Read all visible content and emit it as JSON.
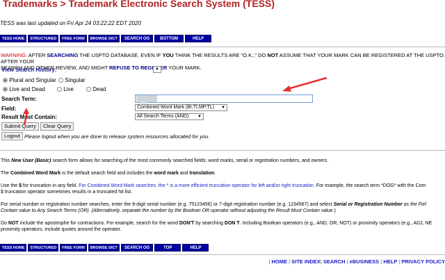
{
  "header": {
    "title_prefix": "Trademarks",
    "title_sep": " > ",
    "title_main": "Trademark Electronic Search System (TESS)",
    "last_updated": "TESS was last updated on Fri Apr 24 03:22:22 EDT 2020"
  },
  "top_nav": [
    "TESS HOME",
    "STRUCTURED",
    "FREE FORM",
    "BROWSE DICT",
    "SEARCH OG",
    "BOTTOM",
    "HELP"
  ],
  "bottom_nav": [
    "TESS HOME",
    "STRUCTURED",
    "FREE FORM",
    "BROWSE DICT",
    "SEARCH OG",
    "TOP",
    "HELP"
  ],
  "warning": {
    "label": "WARNING:",
    "t1": " AFTER ",
    "searching": "SEARCHING",
    "t2": " THE USPTO DATABASE, EVEN IF ",
    "you": "YOU",
    "t3": " THINK THE RESULTS ARE \"O.K.,\" DO ",
    "not": "NOT",
    "t4": " ASSUME THAT YOUR MARK CAN BE REGISTERED AT THE USPTO. AFTER YOUR",
    "t5": "SEARCH AND OTHER REVIEW, AND MIGHT ",
    "refuse": "REFUSE TO REGISTER",
    "t6": " YOUR MARK."
  },
  "form": {
    "view_history_label": "View Search History:",
    "plural_singular": "Plural and Singular",
    "singular": "Singular",
    "live_dead": "Live and Dead",
    "live": "Live",
    "dead": "Dead",
    "search_term_label": "Search Term:",
    "field_label": "Field:",
    "field_value": "Combined Word Mark (BI,TI,MP,TL)",
    "result_label": "Result Must Contain:",
    "result_value": "All Search Terms (AND)",
    "submit": "Submit Query",
    "clear": "Clear Query",
    "logout": "Logout",
    "logout_note": "Please logout when you are done to release system resources allocated for you."
  },
  "info": {
    "p1_a": "This ",
    "p1_b": "New User (Basic)",
    "p1_c": " search form allows for searching of the most commonly searched fields: word marks, serial or registration numbers, and owners.",
    "p2_a": "The ",
    "p2_b": "Combined Word Mark",
    "p2_c": " is the default search field and includes the ",
    "p2_d": "word mark",
    "p2_e": " and ",
    "p2_f": "translation",
    "p2_g": ".",
    "p3_a": "Use the ",
    "p3_b": "$",
    "p3_c": " for truncation in any field. ",
    "p3_d": "For Combined Word Mark searches, the * is a more efficient truncation operator for left and/or right truncation.",
    "p3_e": " For example, the search term *DOG* with the Com",
    "p3_f": "$ truncation operator sometimes results in a truncated hit list.",
    "p4_a": "For serial number or registration number searches, enter the 8-digit serial number (e.g. 75123456) or 7-digit registration number (e.g. 1234567) and select ",
    "p4_b": "Serial or Registration Number",
    "p4_c": " as the Fiel",
    "p4_d": "Contain value to Any Search Terms (OR). (Alternatively, separate the number by the Boolean OR operator without adjusting the ",
    "p4_e": "Result Must Contain",
    "p4_f": " value.)",
    "p5_a": "Do ",
    "p5_b": "NOT",
    "p5_c": " include the apostrophe for contractions. For example, search for the word ",
    "p5_d": "DON'T",
    "p5_e": " by searching ",
    "p5_f": "DON T",
    "p5_g": ". Including Boolean operators (e.g., AND, OR, NOT) or proximity operators (e.g., ADJ, NE",
    "p5_h": "proximity operators, include quotes around the operator."
  },
  "footer": [
    "HOME",
    "SITE INDEX",
    "SEARCH",
    "eBUSINESS",
    "HELP",
    "PRIVACY POLICY"
  ],
  "footer_sep": "|",
  "colors": {
    "nav_bg": "#0000a0",
    "title": "#b22222",
    "warning": "#d00000",
    "arrow": "#e53030"
  }
}
